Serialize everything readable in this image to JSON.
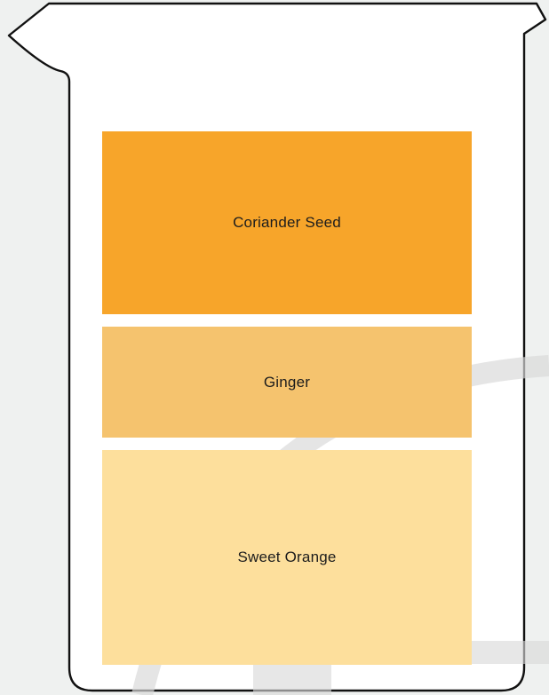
{
  "layers": [
    {
      "label": "Coriander Seed",
      "color": "#f7a52a"
    },
    {
      "label": "Ginger",
      "color": "#f5c36e"
    },
    {
      "label": "Sweet Orange",
      "color": "#fddf9c"
    }
  ],
  "colors": {
    "background": "#eff1f0",
    "watermark": "#d9d9d9",
    "beaker_fill": "#ffffff",
    "beaker_outline": "#111111"
  },
  "icons": {
    "beaker": "beaker-icon"
  }
}
